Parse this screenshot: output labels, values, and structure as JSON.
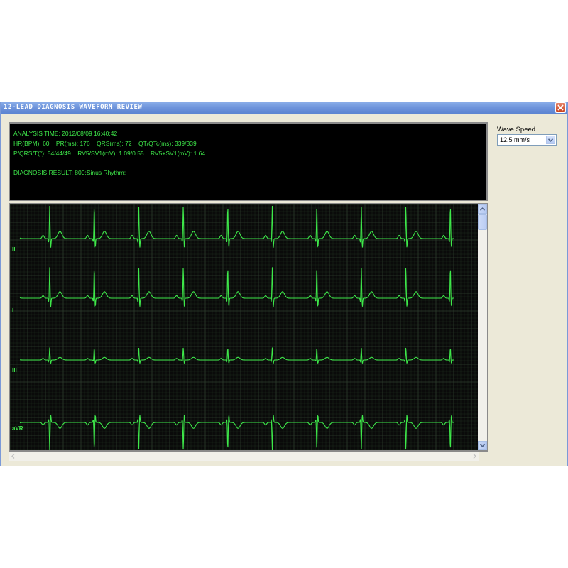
{
  "window": {
    "title": "12-LEAD DIAGNOSIS WAVEFORM REVIEW"
  },
  "analysis": {
    "line1": [
      "ANALYSIS TIME:  2012/08/09 16:40:42"
    ],
    "line2": [
      "HR(BPM):  60",
      "PR(ms): 176",
      "QRS(ms): 72",
      "QT/QTc(ms): 339/339"
    ],
    "line3": [
      "P/QRS/T(°):  54/44/49",
      "RV5/SV1(mV): 1.09/0.55",
      "RV5+SV1(mV): 1.64"
    ],
    "line4": [
      "DIAGNOSIS RESULT:  800:Sinus Rhythm;"
    ]
  },
  "controls": {
    "wave_speed_label": "Wave Speed",
    "wave_speed_value": "12.5 mm/s"
  },
  "waveforms": {
    "leads": [
      {
        "label": "II",
        "r_amplitude": 1.0,
        "t_amplitude": 0.22,
        "p_amplitude": 0.1,
        "inverted": false
      },
      {
        "label": "I",
        "r_amplitude": 0.95,
        "t_amplitude": 0.2,
        "p_amplitude": 0.08,
        "inverted": false
      },
      {
        "label": "III",
        "r_amplitude": 0.38,
        "t_amplitude": 0.08,
        "p_amplitude": 0.05,
        "inverted": false
      },
      {
        "label": "aVR",
        "r_amplitude": 0.85,
        "t_amplitude": 0.18,
        "p_amplitude": 0.08,
        "inverted": true
      }
    ],
    "beats_visible": 10,
    "colors": {
      "background": "#0a0a0a",
      "grid_minor": "#1c2a1c",
      "grid_major": "#2e3e2e",
      "trace": "#3ee84a",
      "label": "#3ee84a"
    }
  }
}
